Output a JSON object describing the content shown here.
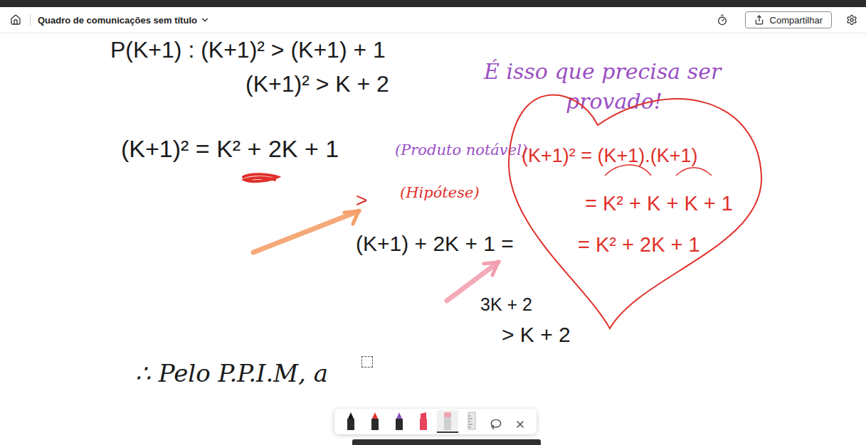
{
  "window": {
    "title": "Quadro de comunicações sem título"
  },
  "header": {
    "share": "Compartilhar"
  },
  "canvas": {
    "items": [
      {
        "kind": "text",
        "text": "P(K+1) :  (K+1)² > (K+1) + 1",
        "color": "#1a1a1a"
      },
      {
        "kind": "text",
        "text": "(K+1)² > K + 2",
        "color": "#1a1a1a"
      },
      {
        "kind": "text",
        "text": "É isso que precisa ser",
        "color": "#9b4fc4"
      },
      {
        "kind": "text",
        "text": "provado!",
        "color": "#9b4fc4"
      },
      {
        "kind": "text",
        "text": "(K+1)² = K² + 2K + 1",
        "color": "#1a1a1a"
      },
      {
        "kind": "scribble",
        "color": "#e0302a"
      },
      {
        "kind": "text",
        "text": "(Produto notável)",
        "color": "#9b4fc4"
      },
      {
        "kind": "heart",
        "color": "#e0302a"
      },
      {
        "kind": "text",
        "text": "(K+1)² = (K+1).(K+1)",
        "color": "#e0302a"
      },
      {
        "kind": "text",
        "text": "= K² + K + K + 1",
        "color": "#e0302a"
      },
      {
        "kind": "text",
        "text": "= K² + 2K + 1",
        "color": "#e0302a"
      },
      {
        "kind": "text",
        "text": ">",
        "color": "#e0302a"
      },
      {
        "kind": "text",
        "text": "(Hipótese)",
        "color": "#e0302a"
      },
      {
        "kind": "arrow",
        "color": "#f4a06a"
      },
      {
        "kind": "text",
        "text": "(K+1) + 2K + 1 =",
        "color": "#1a1a1a"
      },
      {
        "kind": "arrow",
        "color": "#f2a0b0"
      },
      {
        "kind": "text",
        "text": "3K + 2",
        "color": "#1a1a1a"
      },
      {
        "kind": "text",
        "text": "> K + 2",
        "color": "#1a1a1a"
      },
      {
        "kind": "text",
        "text": "∴ Pelo P.P.I.M, a",
        "color": "#1a1a1a"
      },
      {
        "kind": "selection",
        "color": "#555555"
      }
    ]
  },
  "toolbar": {
    "tools": [
      {
        "kind": "pen",
        "color": "#111111",
        "selected": false
      },
      {
        "kind": "pen",
        "color": "#e0302a",
        "selected": false
      },
      {
        "kind": "pen",
        "color": "#8a4fc4",
        "selected": false
      },
      {
        "kind": "highlighter",
        "color": "#e8435a",
        "selected": false
      },
      {
        "kind": "eraser",
        "color": "#f2a0b0",
        "selected": true
      },
      {
        "kind": "ruler",
        "color": "#bbbbbb",
        "selected": false
      },
      {
        "kind": "lasso",
        "color": "#444444",
        "selected": false
      },
      {
        "kind": "close",
        "color": "#444444",
        "selected": false
      }
    ]
  }
}
